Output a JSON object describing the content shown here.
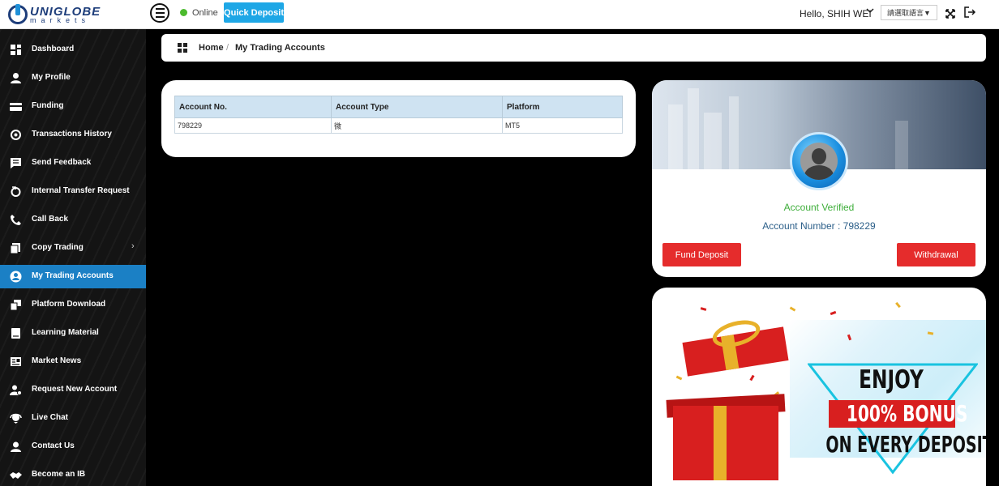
{
  "header": {
    "logo_name": "UNIGLOBE",
    "logo_sub": "markets",
    "status": "Online",
    "quick_deposit": "Quick Deposit",
    "greeting": "Hello, SHIH WEI",
    "language": "請選取語言▼",
    "colors": {
      "online": "#4cba2e",
      "quick_deposit": "#1ea7e6"
    }
  },
  "sidebar": {
    "items": [
      {
        "label": "Dashboard",
        "icon": "dashboard-icon"
      },
      {
        "label": "My Profile",
        "icon": "user-icon"
      },
      {
        "label": "Funding",
        "icon": "wallet-icon"
      },
      {
        "label": "Transactions History",
        "icon": "history-icon"
      },
      {
        "label": "Send Feedback",
        "icon": "feedback-icon"
      },
      {
        "label": "Internal Transfer Request",
        "icon": "transfer-icon"
      },
      {
        "label": "Call Back",
        "icon": "phone-icon"
      },
      {
        "label": "Copy Trading",
        "icon": "copy-icon"
      },
      {
        "label": "My Trading Accounts",
        "icon": "account-icon"
      },
      {
        "label": "Platform Download",
        "icon": "download-icon"
      },
      {
        "label": "Learning Material",
        "icon": "book-icon"
      },
      {
        "label": "Market News",
        "icon": "news-icon"
      },
      {
        "label": "Request New Account",
        "icon": "add-user-icon"
      },
      {
        "label": "Live Chat",
        "icon": "chat-icon"
      },
      {
        "label": "Contact Us",
        "icon": "contact-icon"
      },
      {
        "label": "Become an IB",
        "icon": "handshake-icon"
      }
    ],
    "active_index": 8,
    "active_color": "#1b80c5"
  },
  "breadcrumb": {
    "home": "Home",
    "separator": "/",
    "current": "My Trading Accounts"
  },
  "accounts": {
    "columns": [
      "Account No.",
      "Account Type",
      "Platform"
    ],
    "rows": [
      [
        "798229",
        "微",
        "MT5"
      ]
    ]
  },
  "profile": {
    "verified": "Account Verified",
    "account_number": "Account Number : 798229",
    "fund_deposit": "Fund Deposit",
    "withdrawal": "Withdrawal",
    "colors": {
      "verified": "#3eae3a",
      "button": "#e52c2c"
    }
  },
  "promo": {
    "line1": "ENJOY",
    "line2": "100% BONUS",
    "line3": "ON EVERY DEPOSIT"
  }
}
